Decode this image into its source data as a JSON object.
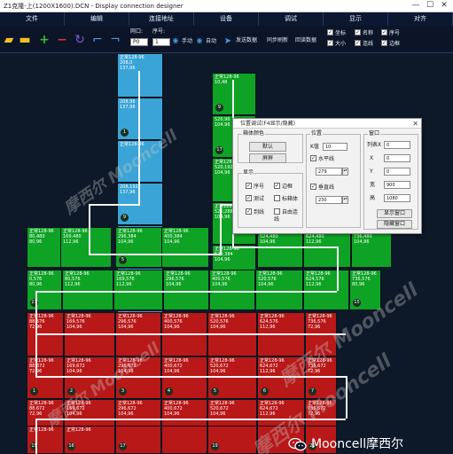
{
  "window": {
    "title": "Z1克隆-上(1200X1600).DCN - Display connection designer",
    "min": "—",
    "max": "☐",
    "close": "✕"
  },
  "menu": [
    "文件",
    "编辑",
    "连接地址",
    "设备",
    "调试",
    "显示",
    "对齐"
  ],
  "toolbar": {
    "port_label": "网口:",
    "port_value": "P0",
    "serial_label": "序号:",
    "serial_value": "1",
    "manual": "手动",
    "auto": "自动",
    "send": "发送数据",
    "readback": "回读数据",
    "save": "同步刷新",
    "checks": [
      {
        "label": "坐标",
        "checked": true
      },
      {
        "label": "名称",
        "checked": true
      },
      {
        "label": "序号",
        "checked": true
      },
      {
        "label": "大小",
        "checked": true
      },
      {
        "label": "连线",
        "checked": true
      },
      {
        "label": "边框",
        "checked": true
      }
    ]
  },
  "tiles": [
    {
      "color": "blue",
      "text": [
        "正常128-96",
        "208,0",
        "137,96"
      ],
      "num": ""
    },
    {
      "color": "blue",
      "text": [
        "208,96",
        "137,96"
      ],
      "num": "1"
    },
    {
      "color": "blue",
      "text": [
        "正常128-96",
        "",
        "",
        ""
      ],
      "num": ""
    },
    {
      "color": "blue",
      "text": [
        "208,192",
        "137,96"
      ],
      "num": "9"
    },
    {
      "color": "blue",
      "text": [
        "正常128-96",
        "208,288",
        "137,96"
      ],
      "num": ""
    },
    {
      "color": "blue",
      "text": [
        "正常128-96",
        "208,384",
        "137,96"
      ],
      "num": ""
    },
    {
      "color": "blue",
      "text": [
        "正常128-96",
        "208,480",
        "137,96"
      ],
      "num": "1"
    },
    {
      "color": "green",
      "text": [
        "正常128-96",
        "10,48"
      ],
      "num": "9"
    },
    {
      "color": "green",
      "text": [
        "520,96",
        "104,96"
      ],
      "num": "17"
    },
    {
      "color": "green",
      "text": [
        "正常128-96",
        "520,192",
        "104,96"
      ],
      "num": ""
    },
    {
      "color": "green",
      "text": [
        "正常128-96",
        "520,288",
        "104,96"
      ],
      "num": ""
    },
    {
      "color": "green",
      "text": [
        "正常128-96",
        "520,384",
        "104,96"
      ],
      "num": "13"
    },
    {
      "color": "green",
      "text": [
        "正常128-96",
        "80,480",
        "80,96"
      ],
      "num": ""
    },
    {
      "color": "green",
      "text": [
        "正常128-96",
        "169,480",
        "112,96"
      ],
      "num": ""
    },
    {
      "color": "green",
      "text": [
        "正常128-96",
        "296,384",
        "104,96"
      ],
      "num": "5"
    },
    {
      "color": "green",
      "text": [
        "正常128-96",
        "400,384",
        "104,96"
      ],
      "num": ""
    },
    {
      "color": "green",
      "text": [
        "正常128-96",
        "524,480",
        "104,96"
      ],
      "num": ""
    },
    {
      "color": "green",
      "text": [
        "正常128-96",
        "624,480",
        "112,96"
      ],
      "num": ""
    },
    {
      "color": "green",
      "text": [
        "正常128-96",
        "736,480",
        "104,96"
      ],
      "num": ""
    },
    {
      "color": "green",
      "text": [
        "正常128-96",
        "0,576",
        "80,96"
      ],
      "num": "21"
    },
    {
      "color": "green",
      "text": [
        "正常128-96",
        "80,576",
        "112,96"
      ],
      "num": ""
    },
    {
      "color": "green",
      "text": [
        "正常128-96",
        "169,576",
        "112,96"
      ],
      "num": ""
    },
    {
      "color": "green",
      "text": [
        "正常128-96",
        "296,576",
        "104,96"
      ],
      "num": ""
    },
    {
      "color": "green",
      "text": [
        "正常128-96",
        "400,576",
        "104,96"
      ],
      "num": ""
    },
    {
      "color": "green",
      "text": [
        "正常128-96",
        "520,576",
        "104,96"
      ],
      "num": ""
    },
    {
      "color": "green",
      "text": [
        "正常128-96",
        "624,576",
        "112,96"
      ],
      "num": ""
    },
    {
      "color": "green",
      "text": [
        "正常128-96",
        "736,576",
        "80,96"
      ],
      "num": "15"
    },
    {
      "color": "red",
      "text": [
        "正常128-96",
        "88,576",
        "72,96"
      ],
      "num": ""
    },
    {
      "color": "red",
      "text": [
        "正常128-96",
        "169,576",
        "104,96"
      ],
      "num": ""
    },
    {
      "color": "red",
      "text": [
        "正常128-96",
        "296,576",
        "104,96"
      ],
      "num": ""
    },
    {
      "color": "red",
      "text": [
        "正常128-96",
        "400,576",
        "104,96"
      ],
      "num": ""
    },
    {
      "color": "red",
      "text": [
        "正常128-96",
        "520,576",
        "104,96"
      ],
      "num": ""
    },
    {
      "color": "red",
      "text": [
        "正常128-96",
        "624,576",
        "112,96"
      ],
      "num": ""
    },
    {
      "color": "red",
      "text": [
        "正常128-96",
        "736,576",
        "72,96"
      ],
      "num": ""
    },
    {
      "color": "red",
      "text": [
        "正常128-96",
        "88,672",
        "72,96"
      ],
      "num": "1"
    },
    {
      "color": "red",
      "text": [
        "正常128-96",
        "169,672",
        "104,96"
      ],
      "num": "2"
    },
    {
      "color": "red",
      "text": [
        "正常128-96",
        "296,672",
        "104,96"
      ],
      "num": "3"
    },
    {
      "color": "red",
      "text": [
        "正常128-96",
        "400,672",
        "104,96"
      ],
      "num": "4"
    },
    {
      "color": "red",
      "text": [
        "正常128-96",
        "520,672",
        "104,96"
      ],
      "num": "5"
    },
    {
      "color": "red",
      "text": [
        "正常128-96",
        "624,672",
        "112,96"
      ],
      "num": "6"
    },
    {
      "color": "red",
      "text": [
        "正常128-96",
        "736,672",
        "72,96"
      ],
      "num": "7"
    },
    {
      "color": "red",
      "text": [
        "正常128-96",
        "88,672",
        "72,96"
      ],
      "num": "14"
    },
    {
      "color": "red",
      "text": [
        "正常128-96",
        "169,672",
        "104,96"
      ],
      "num": "13"
    },
    {
      "color": "red",
      "text": [
        "正常128-96",
        "296,672",
        "104,96"
      ],
      "num": "12"
    },
    {
      "color": "red",
      "text": [
        "正常128-96",
        "400,672",
        "104,96"
      ],
      "num": "11"
    },
    {
      "color": "red",
      "text": [
        "正常128-96",
        "520,672",
        "104,96"
      ],
      "num": "10"
    },
    {
      "color": "red",
      "text": [
        "正常128-96",
        "624,672",
        "112,96"
      ],
      "num": "9"
    },
    {
      "color": "red",
      "text": [
        "正常128-96",
        "736,672",
        "72,96"
      ],
      "num": "8"
    },
    {
      "color": "red",
      "text": [
        "正常128-96",
        "88,768",
        "72,96"
      ],
      "num": ""
    },
    {
      "color": "red",
      "text": [
        "正常128-96",
        "169,768",
        "104,96"
      ],
      "num": ""
    },
    {
      "color": "red",
      "text": [
        "正常128-96",
        "296,768",
        "104,96"
      ],
      "num": ""
    },
    {
      "color": "red",
      "text": [
        "正常128-96",
        "400,768",
        "104,96"
      ],
      "num": ""
    },
    {
      "color": "red",
      "text": [
        "正常128-96",
        "520,768",
        "104,96"
      ],
      "num": ""
    },
    {
      "color": "red",
      "text": [
        "正常128-96",
        "624,768",
        "112,96"
      ],
      "num": ""
    },
    {
      "color": "red",
      "text": [
        "正常128-96",
        "736,768",
        "72,96"
      ],
      "num": ""
    },
    {
      "color": "red",
      "text": [
        "正常128-96",
        "",
        "",
        ""
      ],
      "num": "15"
    },
    {
      "color": "red",
      "text": [
        "正常128-96",
        "",
        "",
        ""
      ],
      "num": "16"
    },
    {
      "color": "red",
      "text": [
        "",
        "",
        ""
      ],
      "num": "17"
    },
    {
      "color": "red",
      "text": [
        "",
        "",
        ""
      ],
      "num": ""
    },
    {
      "color": "red",
      "text": [
        "",
        "",
        ""
      ],
      "num": "19"
    },
    {
      "color": "red",
      "text": [
        "",
        "",
        ""
      ],
      "num": ""
    },
    {
      "color": "red",
      "text": [
        "",
        "",
        ""
      ],
      "num": "21"
    }
  ],
  "dialog": {
    "title": "位置调试(F4显示/隐藏)",
    "close": "✕",
    "group_color": "箱体颜色",
    "btn_default": "默认",
    "btn_screen": "屏屏",
    "group_display": "显示",
    "display_checks": [
      {
        "label": "序号",
        "checked": true
      },
      {
        "label": "边框",
        "checked": true
      },
      {
        "label": "测试",
        "checked": true
      },
      {
        "label": "标箱体",
        "checked": false
      },
      {
        "label": "到线",
        "checked": true
      },
      {
        "label": "自由连线",
        "checked": false
      }
    ],
    "group_position": "位置",
    "k_label": "K值",
    "k_value": "10",
    "h_label": "水平线",
    "h_checked": true,
    "h_value": "279",
    "v_label": "垂直线",
    "v_checked": true,
    "v_value": "230",
    "group_window": "窗口",
    "win_rows": [
      {
        "label": "列表X",
        "value": "0"
      },
      {
        "label": "X",
        "value": "0"
      },
      {
        "label": "Y",
        "value": "0"
      },
      {
        "label": "宽",
        "value": "900"
      },
      {
        "label": "高",
        "value": "1080"
      }
    ],
    "btn_show": "显示窗口",
    "btn_hide": "隐藏窗口"
  },
  "watermarks": [
    "摩西尔 Mooncell",
    "摩西尔 Mooncell",
    "摩西尔 Mooncell",
    "摩西尔 Mooncell"
  ],
  "footer": "Mooncell摩西尔",
  "colors": {
    "blue": "#3aa4d6",
    "green": "#0ea324",
    "red": "#b81818",
    "background": "#0d1829"
  }
}
